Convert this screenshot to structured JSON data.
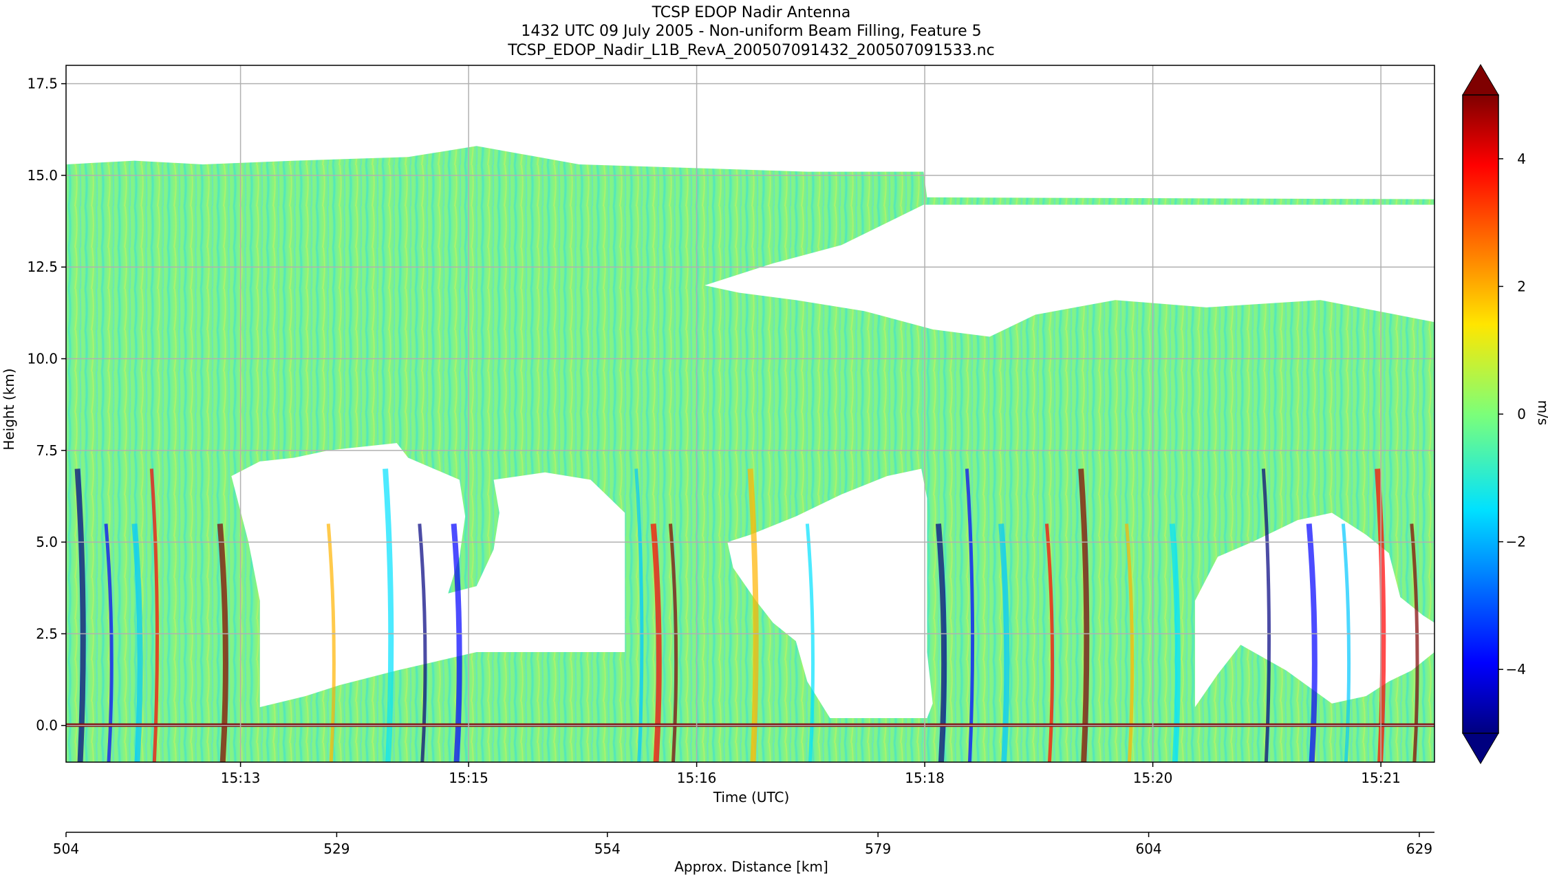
{
  "chart_data": {
    "type": "heatmap",
    "title": [
      "TCSP EDOP Nadir Antenna",
      "1432 UTC 09 July 2005 - Non-uniform Beam Filling, Feature 5",
      "TCSP_EDOP_Nadir_L1B_RevA_200507091432_200507091533.nc"
    ],
    "ylabel": "Height (km)",
    "xlabel": "Time (UTC)",
    "x2label": "Approx. Distance [km]",
    "colorbar_label": "m/s",
    "ylim": [
      -1.0,
      18.0
    ],
    "yticks": [
      0.0,
      2.5,
      5.0,
      7.5,
      10.0,
      12.5,
      15.0,
      17.5
    ],
    "xlim_minutes": [
      0,
      12
    ],
    "xticks": [
      {
        "label": "15:13",
        "t": 1.53
      },
      {
        "label": "15:15",
        "t": 3.53
      },
      {
        "label": "15:16",
        "t": 5.53
      },
      {
        "label": "15:18",
        "t": 7.53
      },
      {
        "label": "15:20",
        "t": 9.53
      },
      {
        "label": "15:21",
        "t": 11.53
      }
    ],
    "distance_range_km": [
      504,
      630.4
    ],
    "distance_ticks": [
      504,
      529,
      554,
      579,
      604,
      629
    ],
    "colorbar_range": [
      -5,
      5
    ],
    "colorbar_ticks": [
      -4,
      -2,
      0,
      2,
      4
    ],
    "colormap": "jet",
    "grid": true,
    "echo_regions": {
      "cloud_top_km": [
        [
          0.0,
          15.3
        ],
        [
          0.6,
          15.4
        ],
        [
          1.2,
          15.3
        ],
        [
          2.0,
          15.4
        ],
        [
          3.0,
          15.5
        ],
        [
          3.6,
          15.8
        ],
        [
          4.5,
          15.3
        ],
        [
          5.5,
          15.2
        ],
        [
          6.5,
          15.1
        ],
        [
          7.52,
          15.1
        ],
        [
          7.55,
          14.4
        ],
        [
          12.0,
          14.35
        ]
      ],
      "echo_free_regions": [
        {
          "name": "upper-right clear zone",
          "polygon_t_km": [
            [
              5.6,
              12.0
            ],
            [
              6.2,
              12.6
            ],
            [
              6.8,
              13.1
            ],
            [
              7.52,
              14.2
            ],
            [
              12.0,
              14.2
            ],
            [
              12.0,
              11.0
            ],
            [
              11.0,
              11.6
            ],
            [
              10.0,
              11.4
            ],
            [
              9.2,
              11.6
            ],
            [
              8.5,
              11.2
            ],
            [
              8.1,
              10.6
            ],
            [
              7.6,
              10.8
            ],
            [
              7.0,
              11.3
            ],
            [
              6.4,
              11.6
            ],
            [
              5.9,
              11.8
            ]
          ]
        },
        {
          "name": "left low clear zone",
          "polygon_t_km": [
            [
              1.45,
              6.8
            ],
            [
              1.7,
              7.2
            ],
            [
              2.0,
              7.3
            ],
            [
              2.3,
              7.5
            ],
            [
              2.9,
              7.7
            ],
            [
              3.0,
              7.3
            ],
            [
              3.45,
              6.7
            ],
            [
              3.5,
              5.7
            ],
            [
              3.45,
              4.6
            ],
            [
              3.35,
              3.6
            ],
            [
              3.6,
              3.8
            ],
            [
              3.75,
              4.8
            ],
            [
              3.8,
              5.8
            ],
            [
              3.75,
              6.7
            ],
            [
              4.2,
              6.9
            ],
            [
              4.6,
              6.7
            ],
            [
              4.9,
              5.8
            ],
            [
              4.9,
              4.0
            ],
            [
              4.9,
              2.0
            ],
            [
              3.6,
              2.0
            ],
            [
              2.9,
              1.5
            ],
            [
              2.4,
              1.1
            ],
            [
              2.1,
              0.8
            ],
            [
              1.7,
              0.5
            ],
            [
              1.7,
              1.8
            ],
            [
              1.7,
              3.4
            ],
            [
              1.6,
              5.0
            ],
            [
              1.5,
              6.2
            ]
          ]
        },
        {
          "name": "middle low clear zone",
          "polygon_t_km": [
            [
              6.0,
              5.2
            ],
            [
              6.4,
              5.7
            ],
            [
              6.8,
              6.3
            ],
            [
              7.2,
              6.8
            ],
            [
              7.5,
              7.0
            ],
            [
              7.55,
              6.2
            ],
            [
              7.55,
              4.0
            ],
            [
              7.55,
              2.0
            ],
            [
              7.6,
              0.6
            ],
            [
              7.55,
              0.2
            ],
            [
              6.7,
              0.2
            ],
            [
              6.5,
              1.2
            ],
            [
              6.4,
              2.3
            ],
            [
              6.2,
              2.8
            ],
            [
              6.05,
              3.4
            ],
            [
              5.85,
              4.3
            ],
            [
              5.8,
              5.0
            ]
          ]
        },
        {
          "name": "right low clear zone",
          "polygon_t_km": [
            [
              9.9,
              3.4
            ],
            [
              10.1,
              4.6
            ],
            [
              10.4,
              5.0
            ],
            [
              10.8,
              5.6
            ],
            [
              11.1,
              5.8
            ],
            [
              11.4,
              5.2
            ],
            [
              11.6,
              4.7
            ],
            [
              11.7,
              3.5
            ],
            [
              11.9,
              3.0
            ],
            [
              12.0,
              2.8
            ],
            [
              12.0,
              2.0
            ],
            [
              11.8,
              1.5
            ],
            [
              11.6,
              1.2
            ],
            [
              11.4,
              0.8
            ],
            [
              11.1,
              0.6
            ],
            [
              10.7,
              1.5
            ],
            [
              10.3,
              2.2
            ],
            [
              10.1,
              1.4
            ],
            [
              9.9,
              0.5
            ],
            [
              9.9,
              2.2
            ]
          ]
        }
      ],
      "surface_height_km": 0.0
    }
  }
}
